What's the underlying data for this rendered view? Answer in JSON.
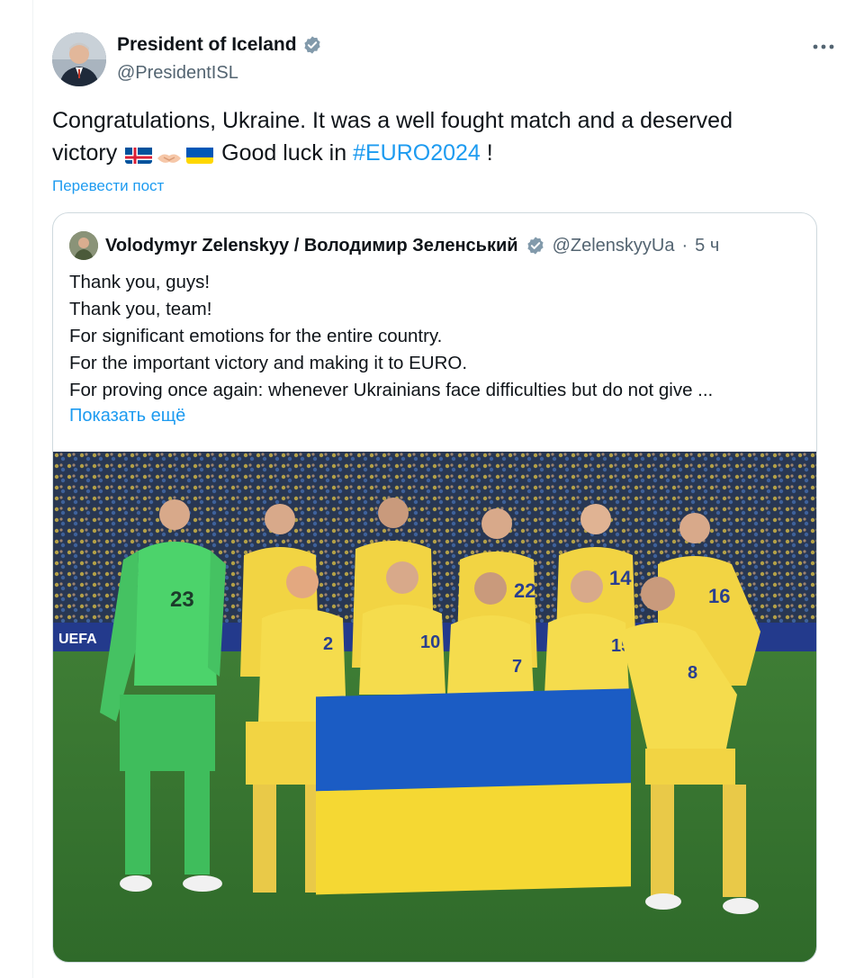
{
  "post": {
    "author": {
      "display_name": "President of Iceland",
      "handle": "@PresidentISL",
      "verified_icon": "verified-badge-icon",
      "avatar_icon": "user-avatar"
    },
    "more_icon": "more-horizontal-icon",
    "text_before": "Congratulations, Ukraine. It was a well fought match and a deserved victory",
    "emoji": [
      "iceland-flag",
      "handshake",
      "ukraine-flag"
    ],
    "text_middle": "Good luck in",
    "hashtag": "#EURO2024",
    "text_after": "!",
    "translate_label": "Перевести пост"
  },
  "quote": {
    "author": {
      "display_name": "Volodymyr Zelenskyy / Володимир Зеленський",
      "handle": "@ZelenskyyUa",
      "separator": "·",
      "time": "5 ч"
    },
    "lines": [
      "Thank you, guys!",
      "Thank you, team!",
      "For significant emotions for the entire country.",
      "For the important victory and making it to EURO.",
      "For proving once again: whenever Ukrainians face difficulties but do not give ..."
    ],
    "show_more_label": "Показать ещё",
    "image": {
      "player_numbers": [
        "23",
        "14",
        "16",
        "22",
        "10",
        "7",
        "15",
        "8",
        "2"
      ],
      "banner_text": "UEFA"
    }
  },
  "colors": {
    "link": "#1d9bf0",
    "secondary_text": "#536471",
    "border": "#cfd9de",
    "verified": "#829aab",
    "kit_yellow": "#f2d443",
    "keeper_green": "#4cd36b",
    "flag_blue": "#1b5cc4",
    "flag_yellow": "#f5d833"
  }
}
